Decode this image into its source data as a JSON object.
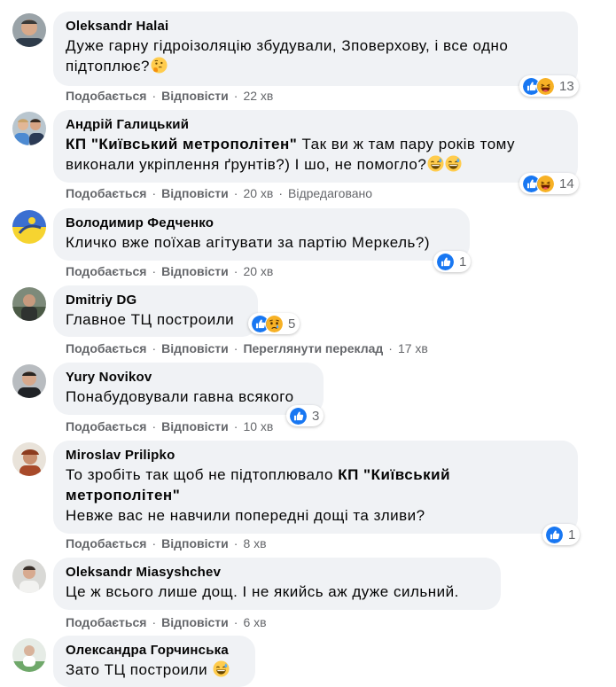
{
  "actions": {
    "like": "Подобається",
    "reply": "Відповісти",
    "sep": "·"
  },
  "colors": {
    "bubble": "#f0f2f5",
    "muted": "#65676b",
    "like_blue": "#1877f2",
    "haha_yellow": "#f7b125"
  },
  "comments": [
    {
      "author": "Oleksandr Halai",
      "lines": [
        "Дуже гарну гідроізоляцію збудували, Зповерхову, і все одно",
        "підтоплює?"
      ],
      "trailing_emoji": "thinking-face",
      "time": "22 хв",
      "reactions": {
        "icons": [
          "like",
          "haha"
        ],
        "count": "13"
      }
    },
    {
      "author": "Андрій Галицький",
      "mention": "КП \"Київський метрополітен\"",
      "lines": [
        "Так ви ж там пару років тому",
        "виконали укріплення ґрунтів?) І шо, не помогло?"
      ],
      "trailing_emoji": "grinning-sweat x2",
      "time": "20 хв",
      "edited": "Відредаговано",
      "reactions": {
        "icons": [
          "like",
          "haha"
        ],
        "count": "14"
      }
    },
    {
      "author": "Володимир Федченко",
      "lines": [
        "Кличко вже поїхав агітувати за партію Меркель?)"
      ],
      "time": "20 хв",
      "reactions": {
        "icons": [
          "like"
        ],
        "count": "1"
      }
    },
    {
      "author": "Dmitriy DG",
      "lines": [
        "Главное ТЦ построили"
      ],
      "time": "",
      "see_translation": "Переглянути переклад",
      "time2": "17 хв",
      "reactions": {
        "icons": [
          "like",
          "sad"
        ],
        "count": "5"
      }
    },
    {
      "author": "Yury Novikov",
      "lines": [
        "Понабудовували гавна всякого"
      ],
      "time": "10 хв",
      "reactions": {
        "icons": [
          "like"
        ],
        "count": "3"
      }
    },
    {
      "author": "Miroslav Prilipko",
      "line1_pre": "То зробіть так щоб не підтоплювало",
      "mention1": "КП \"Київський",
      "mention2": "метрополітен\"",
      "line3": "Невже вас не навчили попередні дощі та зливи?",
      "time": "8 хв",
      "reactions": {
        "icons": [
          "like"
        ],
        "count": "1"
      }
    },
    {
      "author": "Oleksandr Miasyshchev",
      "lines": [
        "Це ж всього лише дощ. І не якийсь аж дуже сильний."
      ],
      "time": "6 хв"
    },
    {
      "author": "Олександра Горчинська",
      "lines": [
        "Зато ТЦ построили"
      ],
      "trailing_emoji": "grinning-sweat"
    }
  ]
}
